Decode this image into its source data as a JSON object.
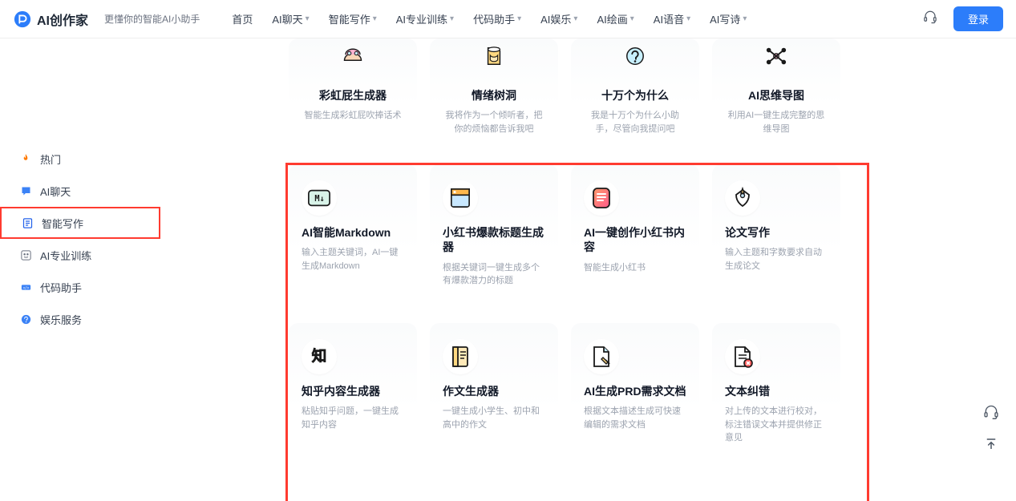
{
  "brand": "AI创作家",
  "tagline": "更懂你的智能AI小助手",
  "nav": [
    {
      "label": "首页",
      "dd": false
    },
    {
      "label": "AI聊天",
      "dd": true
    },
    {
      "label": "智能写作",
      "dd": true
    },
    {
      "label": "AI专业训练",
      "dd": true
    },
    {
      "label": "代码助手",
      "dd": true
    },
    {
      "label": "AI娱乐",
      "dd": true
    },
    {
      "label": "AI绘画",
      "dd": true
    },
    {
      "label": "AI语音",
      "dd": true
    },
    {
      "label": "AI写诗",
      "dd": true
    }
  ],
  "login": "登录",
  "sidebar": [
    {
      "label": "热门"
    },
    {
      "label": "AI聊天"
    },
    {
      "label": "智能写作"
    },
    {
      "label": "AI专业训练"
    },
    {
      "label": "代码助手"
    },
    {
      "label": "娱乐服务"
    }
  ],
  "rows": [
    [
      {
        "title": "彩虹屁生成器",
        "desc": "智能生成彩虹屁吹捧话术"
      },
      {
        "title": "情绪树洞",
        "desc": "我将作为一个倾听者，把你的烦恼都告诉我吧"
      },
      {
        "title": "十万个为什么",
        "desc": "我是十万个为什么小助手，尽管向我提问吧"
      },
      {
        "title": "AI思维导图",
        "desc": "利用AI一键生成完整的思维导图"
      }
    ],
    [
      {
        "title": "AI智能Markdown",
        "desc": "输入主题关键词，AI一键生成Markdown"
      },
      {
        "title": "小红书爆款标题生成器",
        "desc": "根据关键词一键生成多个有爆款潜力的标题"
      },
      {
        "title": "AI一键创作小红书内容",
        "desc": "智能生成小红书"
      },
      {
        "title": "论文写作",
        "desc": "输入主题和字数要求自动生成论文"
      }
    ],
    [
      {
        "title": "知乎内容生成器",
        "desc": "粘贴知乎问题，一键生成知乎内容"
      },
      {
        "title": "作文生成器",
        "desc": "一键生成小学生、初中和高中的作文"
      },
      {
        "title": "AI生成PRD需求文档",
        "desc": "根据文本描述生成可快速编辑的需求文档"
      },
      {
        "title": "文本纠错",
        "desc": "对上传的文本进行校对，标注错误文本并提供修正意见"
      }
    ]
  ]
}
